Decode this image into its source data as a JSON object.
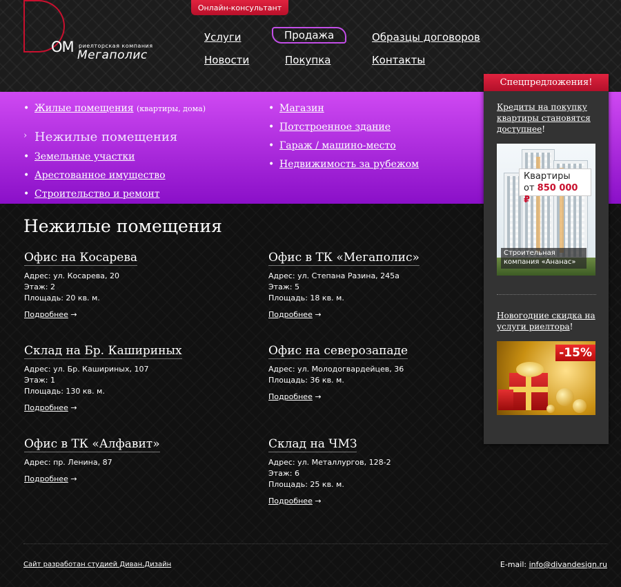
{
  "header": {
    "consult_button": "Онлайн-консультант",
    "logo": {
      "om": "ОМ",
      "subtitle": "риелторская компания",
      "name": "Мегаполис"
    },
    "nav": [
      {
        "label": "Услуги"
      },
      {
        "label": "Продажа"
      },
      {
        "label": "Образцы договоров"
      },
      {
        "label": "Новости"
      },
      {
        "label": "Покупка"
      },
      {
        "label": "Контакты"
      }
    ],
    "nav_active": "Продажа"
  },
  "categories": {
    "left": [
      {
        "label": "Жилые помещения",
        "note": "(квартиры, дома)"
      },
      {
        "label": "Нежилые помещения",
        "note": ""
      },
      {
        "label": "Земельные участки",
        "note": ""
      },
      {
        "label": "Арестованное имущество",
        "note": ""
      },
      {
        "label": "Строительство и ремонт",
        "note": ""
      }
    ],
    "right": [
      {
        "label": "Магазин"
      },
      {
        "label": "Потстроенное здание"
      },
      {
        "label": "Гараж / машино-место"
      },
      {
        "label": "Недвижимость за рубежом"
      }
    ],
    "current": "Нежилые помещения"
  },
  "main": {
    "title": "Нежилые помещения",
    "more_label": "Подробнее",
    "more_arrow": "→",
    "listings": [
      {
        "title": "Офис на Косарева",
        "lines": [
          "Адрес: ул. Косарева, 20",
          "Этаж: 2",
          "Площадь: 20 кв. м."
        ]
      },
      {
        "title": "Офис в ТК «Мегаполис»",
        "lines": [
          "Адрес: ул. Степана Разина, 245а",
          "Этаж: 5",
          "Площадь: 18 кв. м."
        ]
      },
      {
        "title": "Склад на Бр. Кашириных",
        "lines": [
          "Адрес: ул. Бр. Кашириных, 107",
          "Этаж: 1",
          "Площадь: 130 кв. м."
        ]
      },
      {
        "title": "Офис на северозападе",
        "lines": [
          "Адрес: ул. Молодогвардейцев, 36",
          "Площадь: 36 кв. м."
        ]
      },
      {
        "title": "Офис в ТК «Алфавит»",
        "lines": [
          "Адрес: пр. Ленина, 87"
        ]
      },
      {
        "title": "Склад на ЧМЗ",
        "lines": [
          "Адрес: ул. Металлургов, 128-2",
          "Этаж: 6",
          "Площадь: 25 кв. м."
        ]
      }
    ]
  },
  "sidebar": {
    "title": "Спецпредложения!",
    "promo1": {
      "link": "Кредиты на покупку квартиры становятся доступнее",
      "suffix": "!"
    },
    "banner1": {
      "line1": "Квартиры",
      "price_prefix": "от",
      "price": "850 000 ₽",
      "caption": "Строительная компания «Ананас»"
    },
    "promo2": {
      "link": "Новогодние скидка на услуги риелтора",
      "suffix": "!"
    },
    "banner2": {
      "discount": "-15%"
    }
  },
  "footer": {
    "credit": "Сайт разработан студией Диван.Дизайн",
    "email_label": "E-mail:",
    "email": "info@divandesign.ru"
  },
  "colors": {
    "accent_red": "#c8102e",
    "purple_top": "#cf49f2",
    "purple_bottom": "#8a10c8",
    "background": "#151515"
  }
}
